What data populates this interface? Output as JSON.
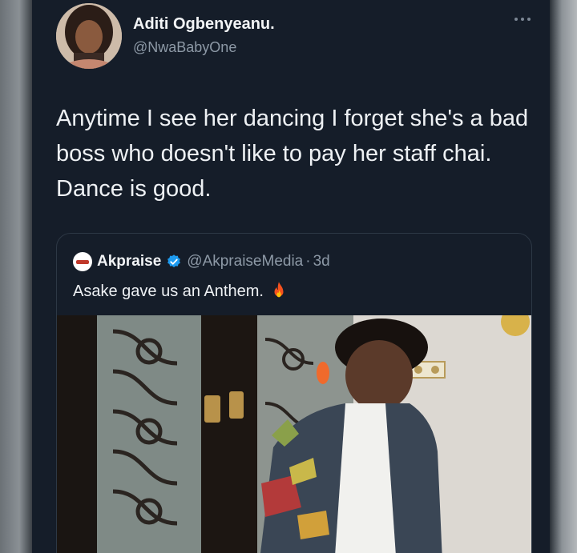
{
  "tweet": {
    "author_name": "Aditi Ogbenyeanu.",
    "author_handle": "@NwaBabyOne",
    "text": "Anytime I see her dancing I forget she's a bad boss who doesn't like to pay her staff chai. Dance is good."
  },
  "quoted_tweet": {
    "author_name": "Akpraise",
    "author_handle": "@AkpraiseMedia",
    "separator": "·",
    "time": "3d",
    "text": "Asake gave us an Anthem.",
    "emoji": "fire-emoji",
    "media_type": "video"
  },
  "icons": {
    "more": "more-options-icon",
    "verified": "verified-badge-icon",
    "logo": "akpraise-logo-icon"
  },
  "colors": {
    "background": "#151d29",
    "primary_text": "#eef1f4",
    "secondary_text": "#8d99a6",
    "verified": "#1d9bf0",
    "border": "#2d3845"
  }
}
